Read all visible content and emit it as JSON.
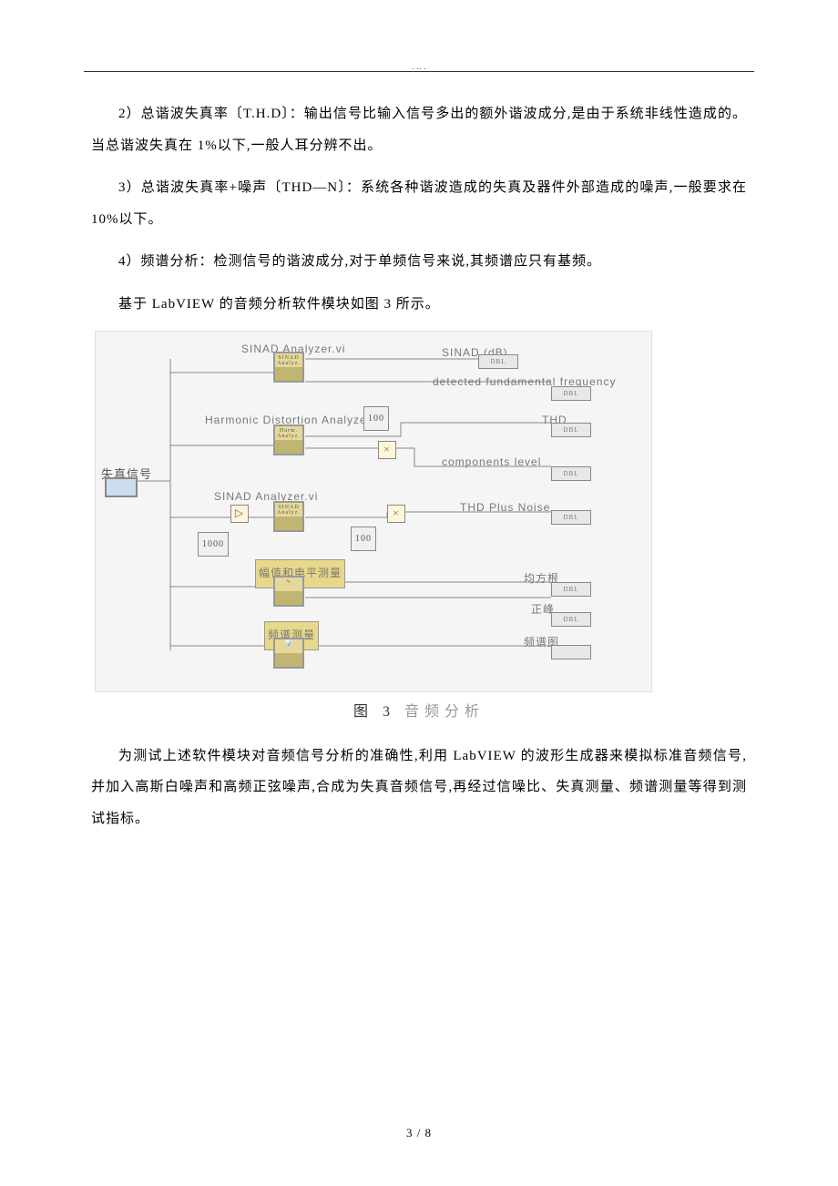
{
  "header": {
    "dots": ".                   ..                   ."
  },
  "paragraphs": {
    "p1": "2）总谐波失真率〔T.H.D〕：输出信号比输入信号多出的额外谐波成分,是由于系统非线性造成的。当总谐波失真在 1%以下,一般人耳分辨不出。",
    "p2": "3）总谐波失真率+噪声〔THD—N〕：系统各种谐波造成的失真及器件外部造成的噪声,一般要求在 10%以下。",
    "p3": "4）频谱分析：检测信号的谐波成分,对于单频信号来说,其频谱应只有基频。",
    "p4": "基于 LabVIEW 的音频分析软件模块如图 3 所示。",
    "p5": "为测试上述软件模块对音频信号分析的准确性,利用 LabVIEW 的波形生成器来模拟标准音频信号,并加入高斯白噪声和高频正弦噪声,合成为失真音频信号,再经过信噪比、失真测量、频谱测量等得到测试指标。"
  },
  "diagram": {
    "caption_prefix": "图 3",
    "caption_suffix": "音频分析",
    "input_label": "失真信号",
    "blocks": {
      "sinad1_label": "SINAD Analyzer.vi",
      "hda_label": "Harmonic Distortion Analyzer.vi",
      "hda_const": "100",
      "sinad2_label": "SINAD Analyzer.vi",
      "sinad2_const1": "1000",
      "sinad2_const2": "100",
      "amp_level_label": "幅值和电平测量",
      "spectrum_label": "频谱测量"
    },
    "outputs": {
      "sinad_db": "SINAD (dB)",
      "detected_freq": "detected fundamental frequency",
      "thd": "THD",
      "comp_level": "components level",
      "thd_noise": "THD Plus Noise",
      "rms": "均方根",
      "pos_peak": "正峰",
      "spectrum_plot": "频谱图"
    },
    "indicator_text": "DBL"
  },
  "page": {
    "number": "3 / 8"
  }
}
